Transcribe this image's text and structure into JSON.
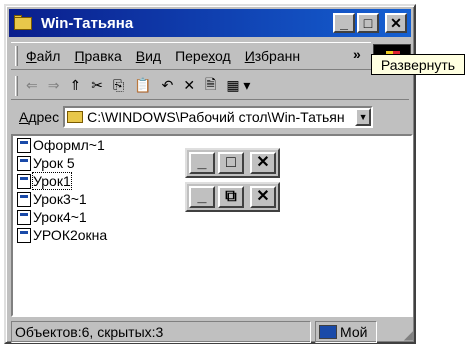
{
  "window": {
    "title": "Win-Татьяна"
  },
  "titlebar_buttons": {
    "minimize": "_",
    "maximize": "□",
    "close": "✕"
  },
  "menu": {
    "items": [
      {
        "pre": "",
        "key": "Ф",
        "post": "айл"
      },
      {
        "pre": "",
        "key": "П",
        "post": "равка"
      },
      {
        "pre": "",
        "key": "В",
        "post": "ид"
      },
      {
        "pre": "Пере",
        "key": "х",
        "post": "од"
      },
      {
        "pre": "",
        "key": "И",
        "post": "збранн"
      }
    ],
    "more": "»"
  },
  "toolbar": {
    "back": "⇐",
    "forward": "⇒",
    "up": "⇑",
    "cut": "✂",
    "copy": "⎘",
    "paste": "📋",
    "undo": "↶",
    "delete": "✕",
    "properties": "🗎",
    "views": "▦ ▾"
  },
  "address": {
    "label_key": "А",
    "label_rest": "дрес",
    "path": "C:\\WINDOWS\\Рабочий стол\\Win-Татьян",
    "dropdown": "▼"
  },
  "files": [
    "Оформл~1",
    "Урок 5",
    "Урок1",
    "Урок3~1",
    "Урок4~1",
    "УРОК2окна"
  ],
  "demo_buttons": {
    "row1": {
      "minimize": "_",
      "maximize": "□",
      "close": "✕"
    },
    "row2": {
      "minimize": "_",
      "restore": "⧉",
      "close": "✕"
    }
  },
  "status": {
    "objects": "Объектов:6, скрытых:3",
    "zone": "Мой"
  },
  "tooltip": {
    "text": "Развернуть"
  },
  "colors": {
    "title_start": "#0a1e8c",
    "title_end": "#1560d2",
    "tooltip_bg": "#ffffe1",
    "window_bg": "#c0c0c0"
  }
}
